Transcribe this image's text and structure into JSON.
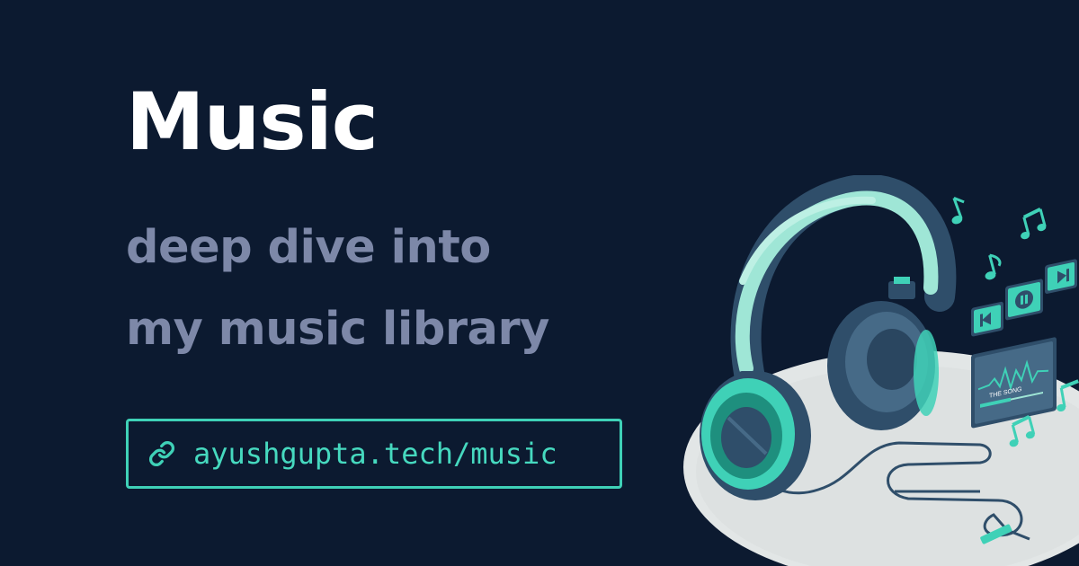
{
  "title": "Music",
  "subtitle": {
    "line1": "deep dive into",
    "line2": "my music library"
  },
  "link": {
    "url_text": "ayushgupta.tech/music",
    "icon": "link-icon"
  },
  "illustration": {
    "player_label": "THE SONG",
    "icons": [
      "headphones-icon",
      "music-note-icon",
      "play-pause-icon",
      "prev-icon",
      "next-icon"
    ]
  },
  "colors": {
    "background": "#0c1a30",
    "title": "#ffffff",
    "subtitle": "#7d88a8",
    "accent": "#3fd1b7",
    "headphone_dark": "#2f4e6a",
    "platform": "#e2e6e6"
  }
}
